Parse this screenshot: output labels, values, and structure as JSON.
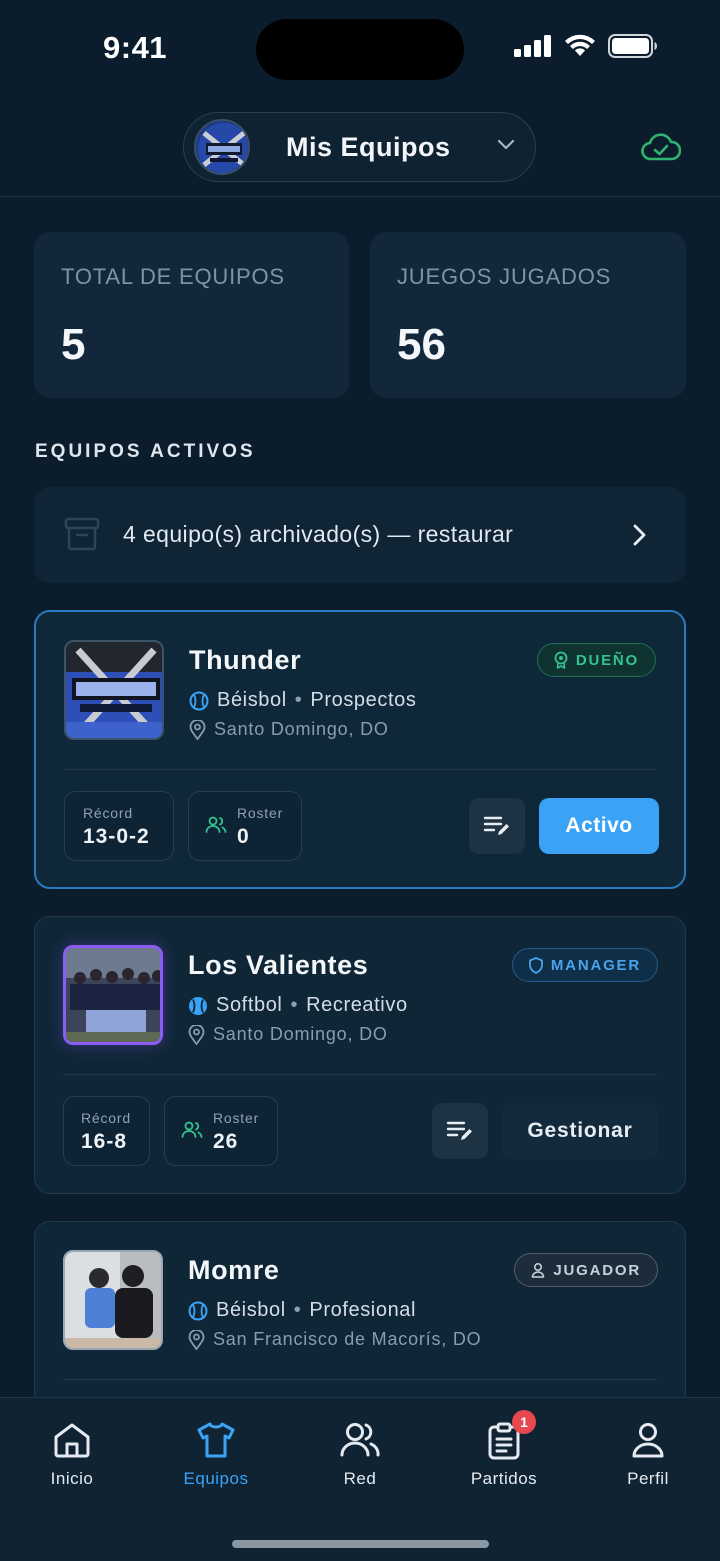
{
  "status_bar": {
    "time": "9:41"
  },
  "header": {
    "title": "Mis Equipos"
  },
  "stats": {
    "total_label": "TOTAL DE EQUIPOS",
    "total_value": "5",
    "games_label": "JUEGOS JUGADOS",
    "games_value": "56"
  },
  "section_title": "EQUIPOS ACTIVOS",
  "archived": {
    "text": "4 equipo(s) archivado(s) — restaurar"
  },
  "teams": [
    {
      "name": "Thunder",
      "sport": "Béisbol",
      "division": "Prospectos",
      "location": "Santo Domingo, DO",
      "role": "DUEÑO",
      "record_label": "Récord",
      "record": "13-0-2",
      "roster_label": "Roster",
      "roster": "0",
      "action": "Activo"
    },
    {
      "name": "Los Valientes",
      "sport": "Softbol",
      "division": "Recreativo",
      "location": "Santo Domingo, DO",
      "role": "MANAGER",
      "record_label": "Récord",
      "record": "16-8",
      "roster_label": "Roster",
      "roster": "26",
      "action": "Gestionar"
    },
    {
      "name": "Momre",
      "sport": "Béisbol",
      "division": "Profesional",
      "location": "San Francisco de Macorís, DO",
      "role": "JUGADOR"
    }
  ],
  "nav": {
    "items": [
      {
        "label": "Inicio",
        "icon": "home-icon"
      },
      {
        "label": "Equipos",
        "icon": "shirt-icon"
      },
      {
        "label": "Red",
        "icon": "users-icon"
      },
      {
        "label": "Partidos",
        "icon": "clipboard-icon",
        "badge": "1"
      },
      {
        "label": "Perfil",
        "icon": "user-icon"
      }
    ]
  },
  "colors": {
    "accent": "#3aa3f5",
    "background": "#0b1c2c",
    "owner": "#34c38f",
    "manager": "#4aa3ec",
    "badge": "#e5484d"
  }
}
